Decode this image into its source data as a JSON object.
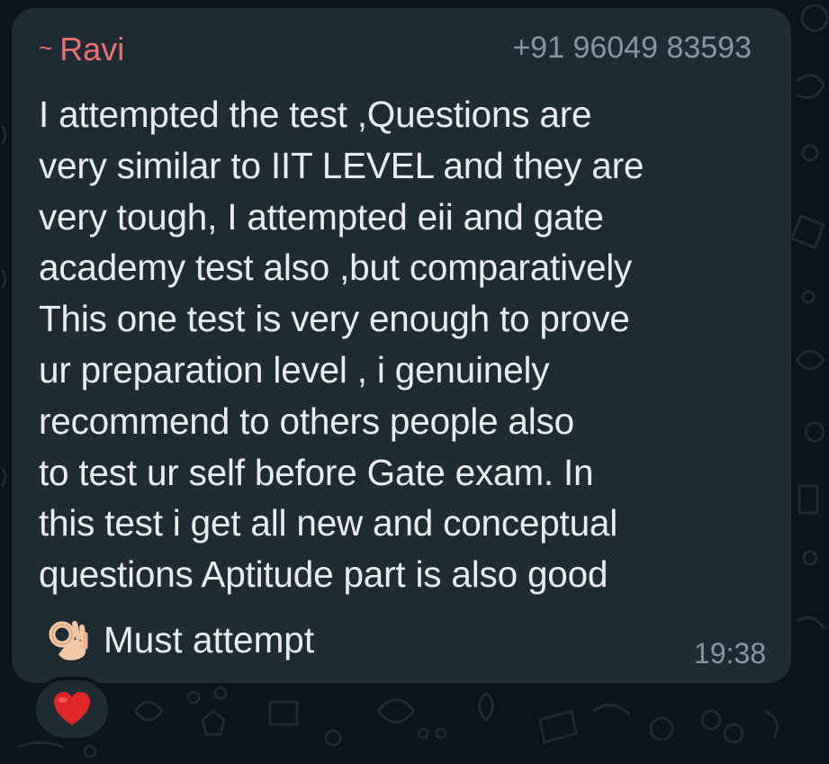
{
  "message": {
    "sender_prefix": "~",
    "sender_name": "Ravi",
    "sender_phone": "+91 96049 83593",
    "lines": [
      "I attempted the test ,Questions are",
      "very similar to IIT LEVEL and they are",
      "very tough, I attempted eii and gate",
      "academy test also ,but comparatively",
      "This one test is very enough to prove",
      "ur preparation level , i genuinely",
      "recommend to others people also",
      "to test ur self before Gate exam.  In",
      "this test i get all new and conceptual",
      "questions Aptitude part is also good"
    ],
    "final_text": "Must attempt",
    "final_emoji": "ok-hand-icon",
    "time": "19:38",
    "reaction_emoji": "red-heart-icon"
  },
  "colors": {
    "background": "#0b141a",
    "bubble": "#1f2c33",
    "sender_name": "#ee6f71",
    "meta_text": "#8696a0",
    "message_text": "#e9edef",
    "reaction_heart": "#e0262b"
  }
}
